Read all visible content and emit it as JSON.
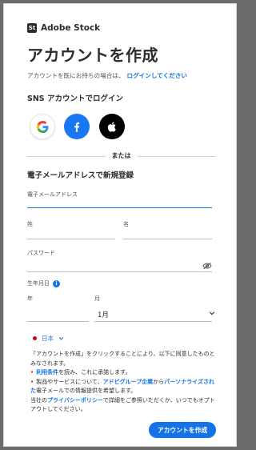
{
  "brand": {
    "logo_text": "St",
    "name": "Adobe Stock"
  },
  "title": "アカウントを作成",
  "subtitle": {
    "text": "アカウントを既にお持ちの場合は、",
    "link": "ログインしてください"
  },
  "sns": {
    "title": "SNS アカウントでログイン",
    "google_icon": "google-icon",
    "facebook_icon": "facebook-icon",
    "apple_icon": "apple-icon"
  },
  "divider_text": "または",
  "email_section": {
    "title": "電子メールアドレスで新規登録",
    "email_label": "電子メールアドレス",
    "last_name_label": "姓",
    "first_name_label": "名",
    "password_label": "パスワード",
    "birth_label": "生年月日",
    "year_label": "年",
    "month_label": "月",
    "month_value": "1月"
  },
  "country": {
    "name": "日本"
  },
  "legal": {
    "intro": "「アカウントを作成」をクリックすることにより、以下に同意したものとみなされます。",
    "line1_link": "利用条件",
    "line1_rest": "を読み、これに承諾します。",
    "line2_pre": "製品やサービスについて、",
    "line2_link1": "アドビグループ企業",
    "line2_mid": "から",
    "line2_link2": "パーソナライズされ",
    "line2_link2b": "た",
    "line2_rest": "電子メールでの情報提供を希望します。",
    "line3_pre": "当社の",
    "line3_link": "プライバシーポリシー",
    "line3_rest": "で詳細をご参照いただくか、いつでもオプトアウトしてください。"
  },
  "submit_label": "アカウントを作成",
  "colors": {
    "accent": "#1473e6",
    "facebook": "#1877f2",
    "bullet": "#cc0000"
  }
}
